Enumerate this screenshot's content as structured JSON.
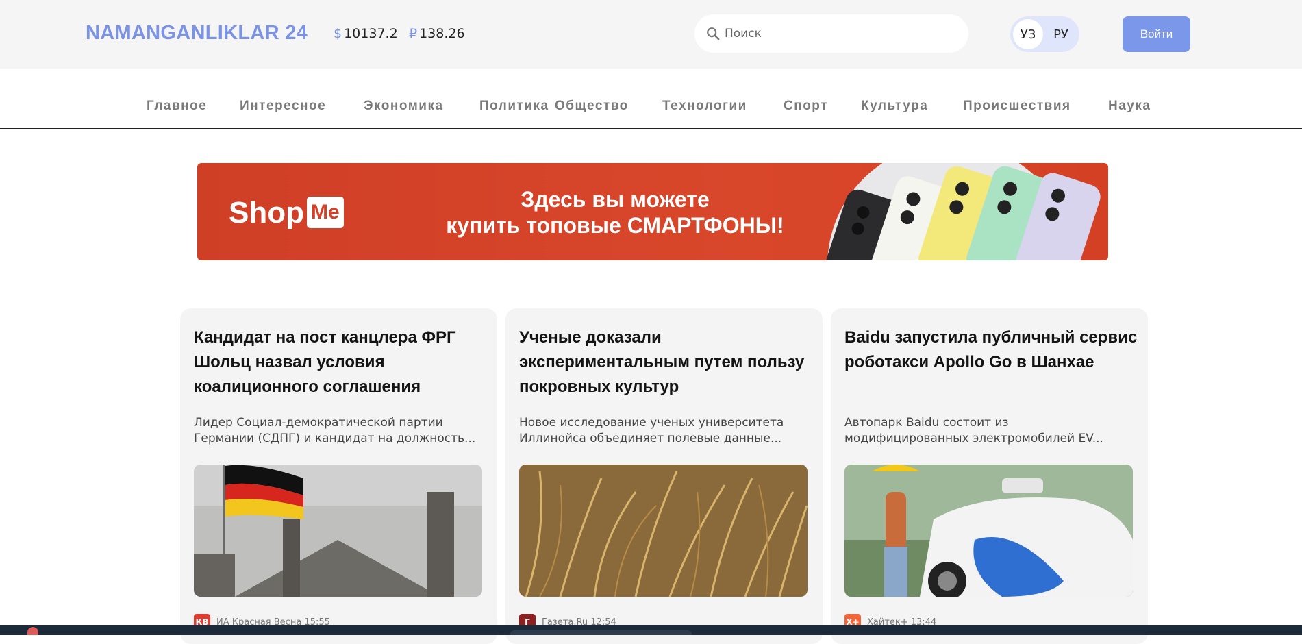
{
  "header": {
    "logo": "NAMANGANLIKLAR 24",
    "rates": [
      {
        "symbol": "$",
        "value": "10137.2"
      },
      {
        "symbol": "₽",
        "value": "138.26"
      }
    ],
    "search": {
      "placeholder": "Поиск",
      "icon": "search-icon"
    },
    "languages": [
      {
        "label": "УЗ",
        "active": true
      },
      {
        "label": "РУ",
        "active": false
      }
    ],
    "login_label": "Войти"
  },
  "nav": {
    "items": [
      "Главное",
      "Интересное",
      "Экономика",
      "Политика",
      "Общество",
      "Технологии",
      "Спорт",
      "Культура",
      "Происшествия",
      "Наука"
    ]
  },
  "banner": {
    "logo_shop": "Shop",
    "logo_me": "Me",
    "line1": "Здесь вы можете",
    "line2": "купить топовые СМАРТФОНЫ!"
  },
  "articles": [
    {
      "title": "Кандидат на пост канцлера ФРГ Шольц назвал условия коалиционного соглашения",
      "description": "Лидер Социал-демократической партии Германии (СДПГ) и кандидат на должность...",
      "source_badge": "КВ",
      "source": "ИА Красная Весна 15:55"
    },
    {
      "title": "Ученые доказали экспериментальным путем пользу покровных культур",
      "description": "Новое исследование ученых университета Иллинойса объединяет полевые данные...",
      "source_badge": "Г",
      "source": "Газета.Ru 12:54"
    },
    {
      "title": "Baidu запустила публичный сервис роботакси Apollo Go в Шанхае",
      "description": "Автопарк Baidu состоит из модифицированных электромобилей EV...",
      "source_badge": "Х+",
      "source": "Хайтек+ 13:44"
    }
  ],
  "colors": {
    "accent": "#7b93e6",
    "button": "#7b97ea",
    "banner": "#d9472b"
  }
}
